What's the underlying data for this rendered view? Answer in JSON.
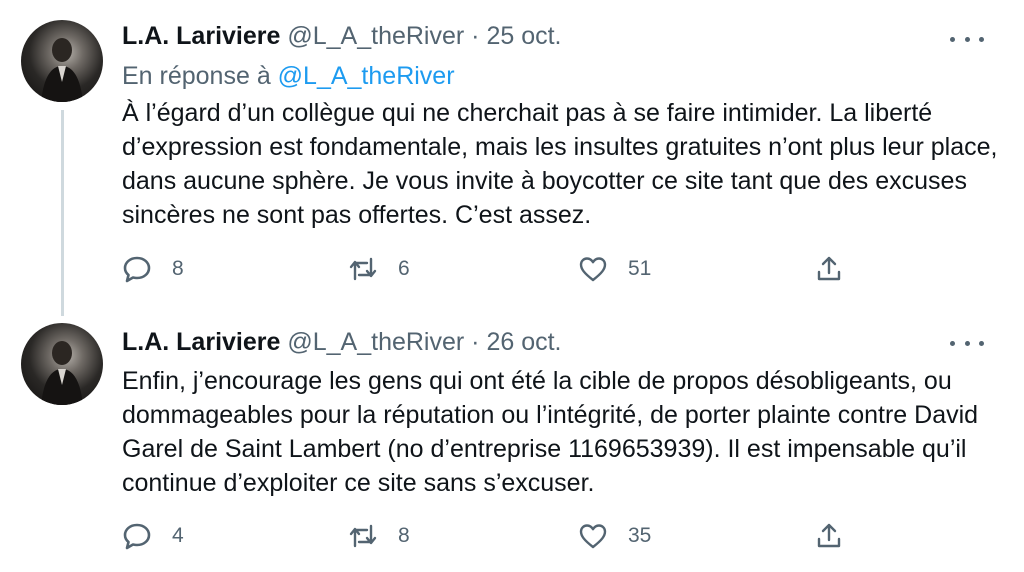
{
  "tweets": [
    {
      "name": "L.A. Lariviere",
      "handle": "@L_A_theRiver",
      "separator": "·",
      "date": "25 oct.",
      "reply_prefix": "En réponse à",
      "reply_mention": "@L_A_theRiver",
      "text": "À l’égard d’un collègue qui ne cherchait pas à se faire intimider. La liberté d’expression est fondamentale, mais les insultes gratuites n’ont plus leur place, dans aucune sphère. Je vous invite à boycotter ce site tant que des excuses sincères ne sont pas offertes. C’est assez.",
      "replies": "8",
      "retweets": "6",
      "likes": "51"
    },
    {
      "name": "L.A. Lariviere",
      "handle": "@L_A_theRiver",
      "separator": "·",
      "date": "26 oct.",
      "text": "Enfin, j’encourage les gens qui ont été la cible de propos désobligeants, ou dommageables pour la réputation ou l’intégrité, de porter plainte contre David Garel de Saint Lambert (no d’entreprise 1169653939). Il est impensable qu’il continue d’exploiter ce site sans s’excuser.",
      "replies": "4",
      "retweets": "8",
      "likes": "35"
    }
  ],
  "icons": {
    "reply": "reply-icon",
    "retweet": "retweet-icon",
    "like": "heart-icon",
    "share": "share-icon",
    "more": "more-icon"
  },
  "colors": {
    "text": "#0f1419",
    "secondary": "#536471",
    "link": "#1d9bf0",
    "thread_line": "#cfd9de"
  }
}
